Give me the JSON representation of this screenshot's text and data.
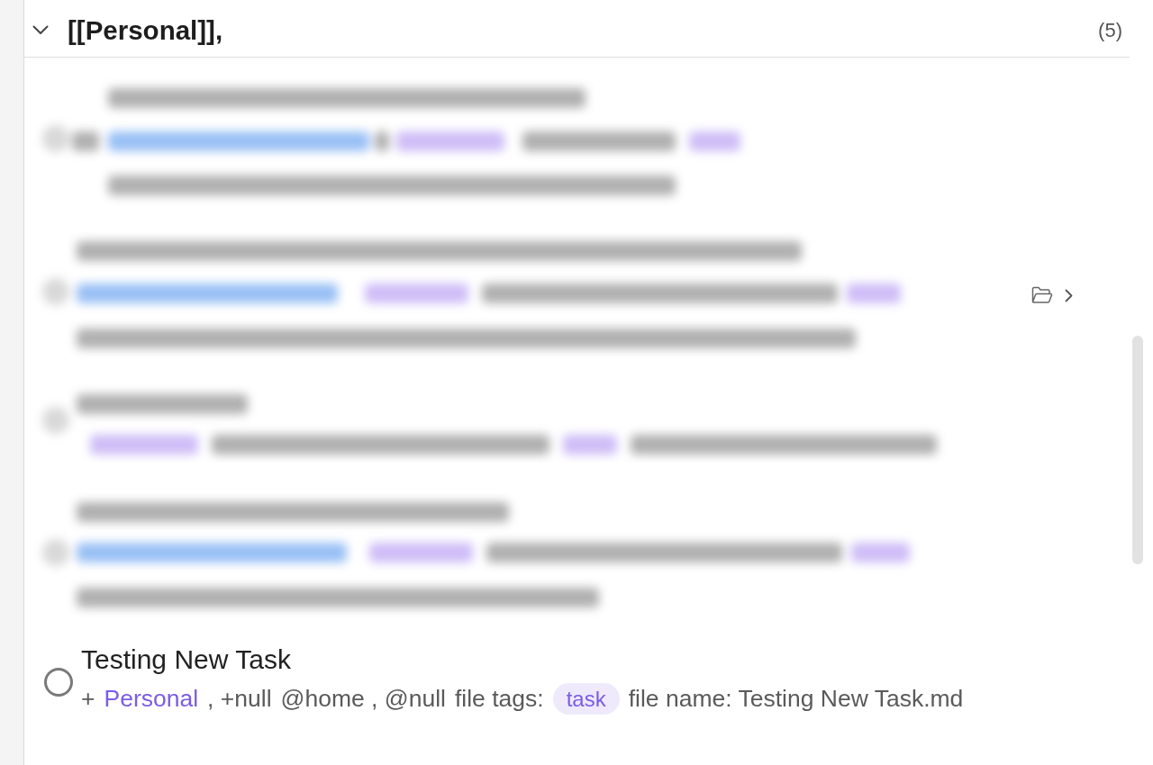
{
  "group": {
    "title": "[[Personal]],",
    "count": "(5)",
    "expanded": true
  },
  "tasks": [
    {
      "kind": "blurred",
      "hovered": false
    },
    {
      "kind": "blurred",
      "hovered": true
    },
    {
      "kind": "blurred",
      "hovered": false
    },
    {
      "kind": "blurred",
      "hovered": false
    },
    {
      "kind": "task",
      "hovered": false,
      "checked": false,
      "title": "Testing New Task",
      "meta": [
        {
          "kind": "text",
          "text": "+"
        },
        {
          "kind": "link",
          "text": "Personal"
        },
        {
          "kind": "text",
          "text": ", +null"
        },
        {
          "kind": "text",
          "text": "@home , @null"
        },
        {
          "kind": "text",
          "text": "file tags:"
        },
        {
          "kind": "tag",
          "text": "task"
        },
        {
          "kind": "text",
          "text": "file name: Testing New Task.md"
        }
      ]
    }
  ]
}
